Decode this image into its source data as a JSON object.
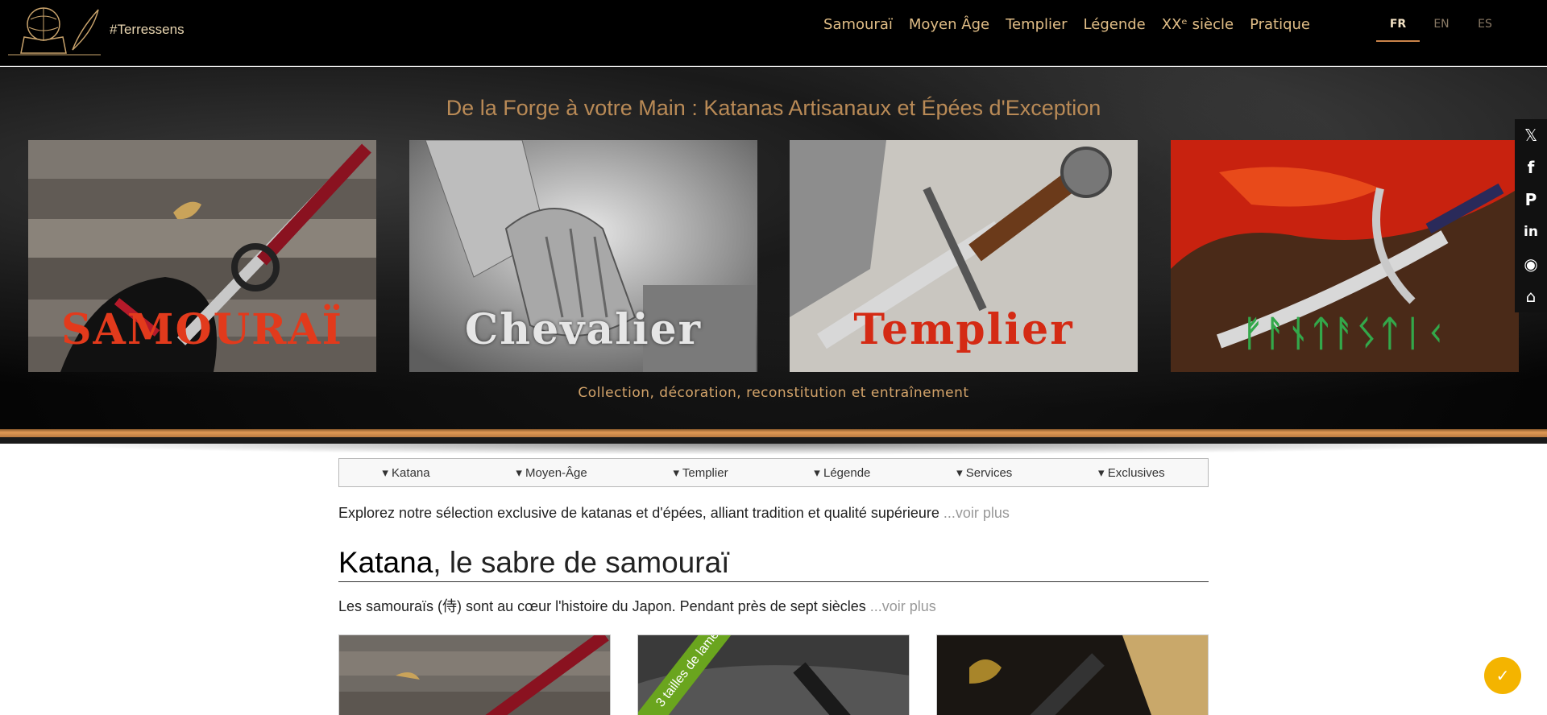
{
  "header": {
    "brand": "#Terressens",
    "nav": [
      "Samouraï",
      "Moyen Âge",
      "Templier",
      "Légende",
      "XXᵉ siècle",
      "Pratique"
    ],
    "search_glyph": "",
    "langs": [
      "FR",
      "EN",
      "ES"
    ],
    "active_lang": "FR"
  },
  "hero": {
    "title": "De la Forge à votre Main : Katanas Artisanaux et Épées d'Exception",
    "cards": [
      {
        "label": "SAMOURAÏ",
        "color": "#e23a1c"
      },
      {
        "label": "Chevalier",
        "color": "#e6e6e6"
      },
      {
        "label": "Templier",
        "color": "#d42a14"
      },
      {
        "label": "ᚠᚨᚾᛏᚨᛊᛏᛁᚲ",
        "color": "#33a84a"
      }
    ],
    "subtitle": "Collection, décoration, reconstitution et entraînement"
  },
  "social": [
    "x-icon",
    "facebook-icon",
    "pinterest-icon",
    "linkedin-icon",
    "reddit-icon",
    "share-icon"
  ],
  "subnav": [
    "▾ Katana",
    "▾ Moyen-Âge",
    "▾ Templier",
    "▾ Légende",
    "▾ Services",
    "▾ Exclusives"
  ],
  "intro": {
    "text": "Explorez notre sélection exclusive de katanas et d'épées, alliant tradition et qualité supérieure ",
    "more": "...voir plus"
  },
  "section": {
    "title_bold": "Katana",
    "title_rest": ", le sabre de samouraï",
    "text": "Les samouraïs (侍) sont au cœur l'histoire du Japon. Pendant près de sept siècles ",
    "more": "...voir plus"
  },
  "products": {
    "ribbon": "3 tailles de lame"
  },
  "colors": {
    "accent": "#e0bd86",
    "border": "#e09a55",
    "cookie": "#f4b400"
  }
}
